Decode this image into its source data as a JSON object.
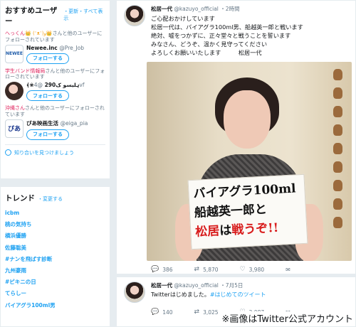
{
  "who_to_follow": {
    "title": "おすすめユーザー",
    "links": "・更新・すべて表示",
    "suggestions": [
      {
        "context_prefix": "へっくん",
        "context_emoji": "👑 (ᵔᴥᵔ)و👑",
        "context_suffix": "さんと他のユーザーにフォローされています",
        "name": "Newee.inc",
        "handle": "@Pre_Job",
        "avatar_text": "NEWEE",
        "button": "フォローする"
      },
      {
        "context_prefix": "学生バンド情報局",
        "context_emoji": "",
        "context_suffix": "さんと他のユーザーにフォローされています",
        "name": "﴾❀ہلیسو ک290",
        "handle": "@4vf",
        "avatar_text": "",
        "button": "フォローする"
      },
      {
        "context_prefix": "沖縄さん",
        "context_emoji": "",
        "context_suffix": "さんと他のユーザーにフォローされています",
        "name": "ぴあ映画生活",
        "handle": "@eiga_pia",
        "avatar_text": "ぴあ",
        "button": "フォローする"
      }
    ],
    "find_friends": "知り合いを見つけましょう"
  },
  "trends": {
    "title": "トレンド",
    "change": "・変更する",
    "items": [
      "icbm",
      "桃の気持ち",
      "横浜優勝",
      "佐藤聡美",
      "#ナンを飛ばす診断",
      "九州豪雨",
      "#ピキニの日",
      "てらしー",
      "バイアグラ100ml男"
    ]
  },
  "tweet1": {
    "name": "松居一代",
    "handle": "@kazuyo_official",
    "time": "・2時間",
    "lines": [
      "ご心配おかけしています",
      "松居一代は、バイアグラ100ml男、船越英一郎と戦います",
      "絶対、嘘をつかずに、正々堂々と戦うことを誓います",
      "みなさん、どうぞ、温かく見守ってください",
      "よろしくお願いいたします　　　松居一代"
    ],
    "board": {
      "line1": "バイアグラ100ml",
      "line2": "船越英一郎と",
      "line3_red": "松居",
      "line3_black": "は",
      "line3_red2": "戦うぞ!!"
    },
    "replies": "386",
    "retweets": "5,870",
    "likes": "3,980"
  },
  "tweet2": {
    "name": "松居一代",
    "handle": "@kazuyo_official",
    "time": "・7月5日",
    "text": "Twitterはじめました。",
    "hashtag": "#はじめてのツイート",
    "replies": "140",
    "retweets": "3,025",
    "likes": "2,087"
  },
  "caption": "※画像はTwitter公式アカウント",
  "icons": {
    "reply": "💬",
    "retweet": "⇄",
    "like": "♡",
    "dm": "✉"
  }
}
